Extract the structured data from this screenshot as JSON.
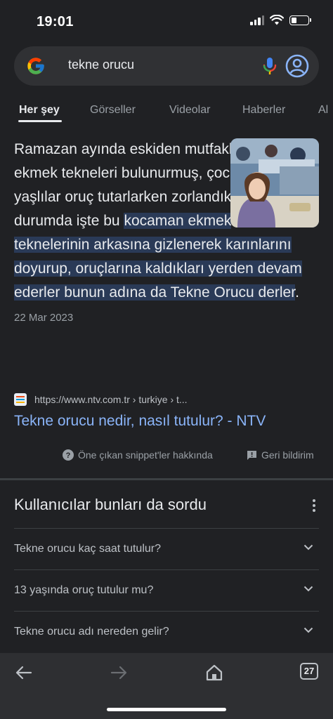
{
  "status_bar": {
    "time": "19:01",
    "battery_level": 0.3
  },
  "search": {
    "query": "tekne orucu"
  },
  "tabs": [
    {
      "label": "Her şey",
      "active": true
    },
    {
      "label": "Görseller",
      "active": false
    },
    {
      "label": "Videolar",
      "active": false
    },
    {
      "label": "Haberler",
      "active": false
    },
    {
      "label": "Al",
      "active": false
    }
  ],
  "snippet": {
    "intro": "Ramazan ayında eskiden mutfaklarda büyük ekmek tekneleri bulunurmuş, çocuklar ve yaşlılar oruç tutarlarken zorlandıkları durumda işte bu ",
    "highlight": "kocaman ekmek teknelerinin arkasına gizlenerek karınlarını doyurup, oruçlarına kaldıkları yerden devam ederler bunun adına da Tekne Orucu derler",
    "period": ".",
    "date": "22 Mar 2023"
  },
  "source": {
    "url": "https://www.ntv.com.tr › turkiye › t...",
    "title": "Tekne orucu nedir, nasıl tutulur? - NTV"
  },
  "feedback": {
    "about_label": "Öne çıkan snippet'ler hakkında",
    "feedback_label": "Geri bildirim"
  },
  "paa": {
    "title": "Kullanıcılar bunları da sordu",
    "questions": [
      "Tekne orucu kaç saat tutulur?",
      "13 yaşında oruç tutulur mu?",
      "Tekne orucu adı nereden gelir?"
    ]
  },
  "toolbar": {
    "tab_count": "27"
  },
  "colors": {
    "background": "#202124",
    "link": "#8ab4f8",
    "highlight": "#2a3a57",
    "toolbar": "#2e2f32"
  }
}
